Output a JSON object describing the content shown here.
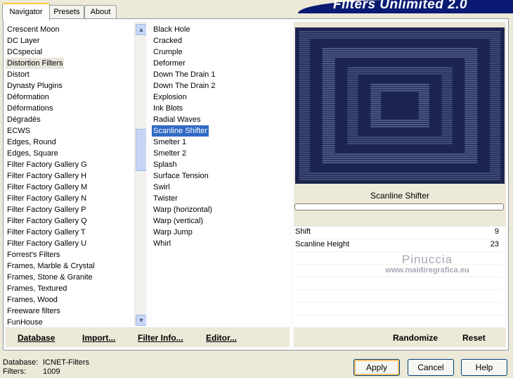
{
  "tabs": [
    {
      "label": "Navigator",
      "active": true
    },
    {
      "label": "Presets",
      "active": false
    },
    {
      "label": "About",
      "active": false
    }
  ],
  "banner": {
    "title": "Filters Unlimited 2.0",
    "color": "#0b1a72"
  },
  "categories": {
    "selected": "Distortion Filters",
    "items": [
      "Crescent Moon",
      "DC Layer",
      "DCspecial",
      "Distortion Filters",
      "Distort",
      "Dynasty Plugins",
      "Déformation",
      "Déformations",
      "Dégradés",
      "ECWS",
      "Edges, Round",
      "Edges, Square",
      "Filter Factory Gallery G",
      "Filter Factory Gallery H",
      "Filter Factory Gallery M",
      "Filter Factory Gallery N",
      "Filter Factory Gallery P",
      "Filter Factory Gallery Q",
      "Filter Factory Gallery T",
      "Filter Factory Gallery U",
      "Forrest's Filters",
      "Frames, Marble & Crystal",
      "Frames, Stone & Granite",
      "Frames, Textured",
      "Frames, Wood",
      "Freeware filters",
      "FunHouse"
    ]
  },
  "filters": {
    "selected": "Scanline Shifter",
    "items": [
      "Black Hole",
      "Cracked",
      "Crumple",
      "Deformer",
      "Down The Drain 1",
      "Down The Drain 2",
      "Explosion",
      "Ink Blots",
      "Radial Waves",
      "Scanline Shifter",
      "Smelter 1",
      "Smelter 2",
      "Splash",
      "Surface Tension",
      "Swirl",
      "Twister",
      "Warp (horizontal)",
      "Warp (vertical)",
      "Warp Jump",
      "Whirl"
    ]
  },
  "preview": {
    "filter_name": "Scanline Shifter",
    "bg_color": "#1c2550",
    "line_color": "#8a9ec6"
  },
  "params": [
    {
      "label": "Shift",
      "value": "9"
    },
    {
      "label": "Scanline Height",
      "value": "23"
    }
  ],
  "watermark": {
    "line1": "Pinuccia",
    "line2": "www.maidiregrafica.eu"
  },
  "left_bar": {
    "database": "Database",
    "import": "Import...",
    "filter_info": "Filter Info...",
    "editor": "Editor..."
  },
  "right_bar": {
    "randomize": "Randomize",
    "reset": "Reset"
  },
  "status": {
    "database_label": "Database:",
    "database_value": "ICNET-Filters",
    "filters_label": "Filters:",
    "filters_value": "1009"
  },
  "buttons": {
    "apply": "Apply",
    "cancel": "Cancel",
    "help": "Help"
  }
}
